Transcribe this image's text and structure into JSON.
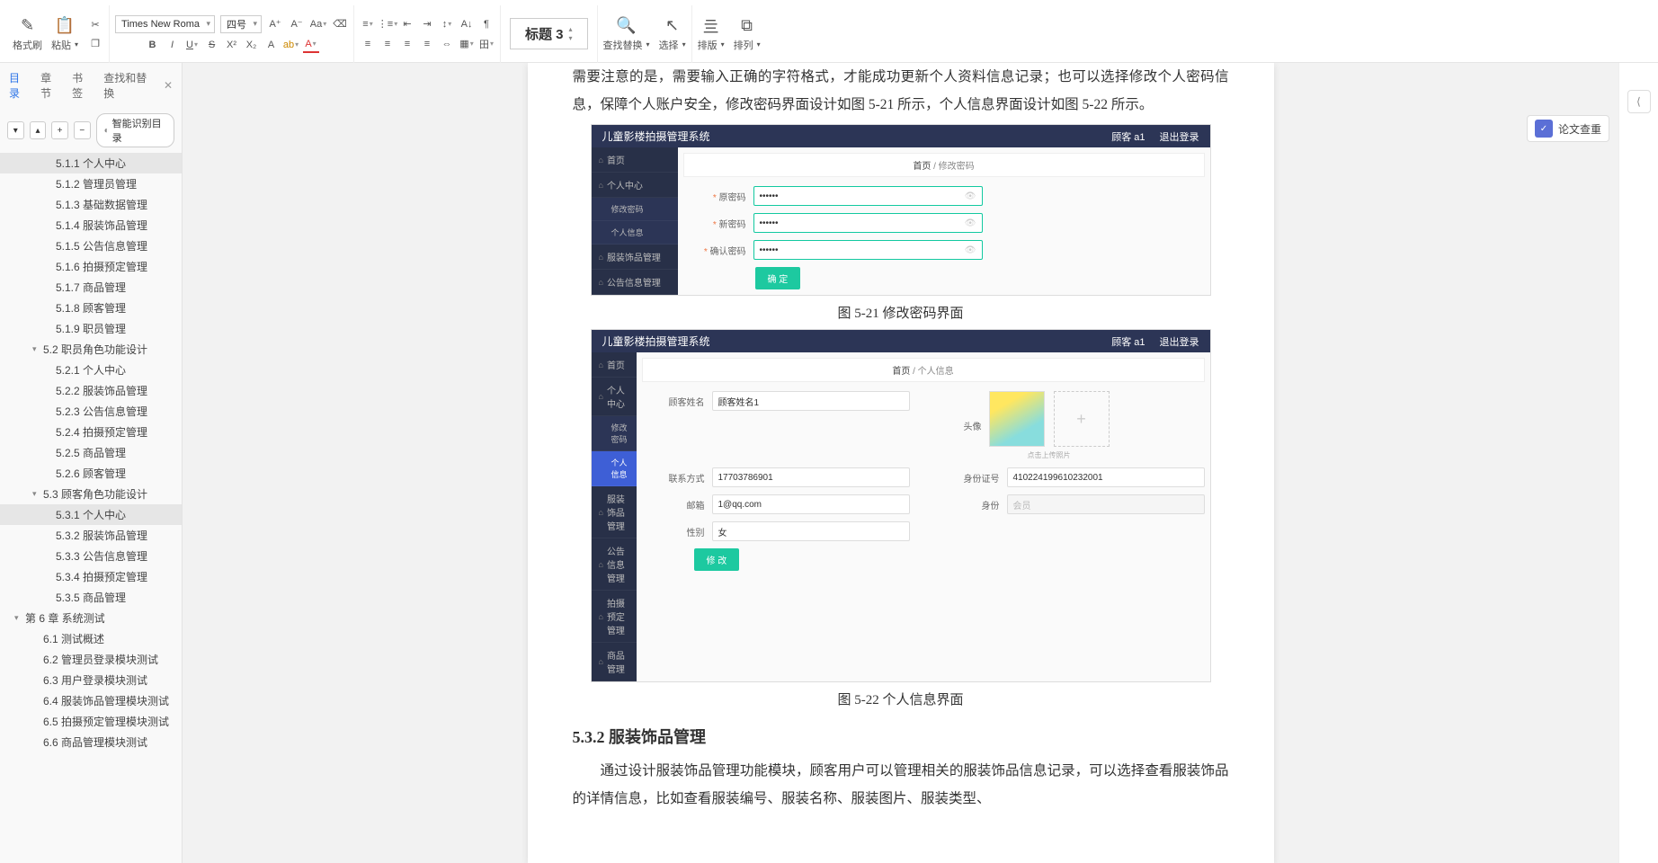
{
  "ribbon": {
    "format_painter": "格式刷",
    "paste": "粘贴",
    "font_name": "Times New Roma",
    "font_size": "四号",
    "style_preview": "标题 3",
    "find_replace": "查找替换",
    "select": "选择",
    "sort": "排版",
    "arrange": "排列"
  },
  "nav": {
    "tabs": {
      "toc": "目录",
      "chapter": "章节",
      "bookmark": "书签",
      "find": "查找和替换"
    },
    "smart": "智能识别目录",
    "items": [
      {
        "txt": "5.1.1 个人中心",
        "lv": 3,
        "active": true
      },
      {
        "txt": "5.1.2 管理员管理",
        "lv": 3
      },
      {
        "txt": "5.1.3 基础数据管理",
        "lv": 3
      },
      {
        "txt": "5.1.4 服装饰品管理",
        "lv": 3
      },
      {
        "txt": "5.1.5 公告信息管理",
        "lv": 3
      },
      {
        "txt": "5.1.6 拍摄预定管理",
        "lv": 3
      },
      {
        "txt": "5.1.7 商品管理",
        "lv": 3
      },
      {
        "txt": "5.1.8 顾客管理",
        "lv": 3
      },
      {
        "txt": "5.1.9 职员管理",
        "lv": 3
      },
      {
        "txt": "5.2 职员角色功能设计",
        "lv": 2,
        "caret": true
      },
      {
        "txt": "5.2.1 个人中心",
        "lv": 3
      },
      {
        "txt": "5.2.2 服装饰品管理",
        "lv": 3
      },
      {
        "txt": "5.2.3 公告信息管理",
        "lv": 3
      },
      {
        "txt": "5.2.4 拍摄预定管理",
        "lv": 3
      },
      {
        "txt": "5.2.5 商品管理",
        "lv": 3
      },
      {
        "txt": "5.2.6 顾客管理",
        "lv": 3
      },
      {
        "txt": "5.3 顾客角色功能设计",
        "lv": 2,
        "caret": true
      },
      {
        "txt": "5.3.1 个人中心",
        "lv": 3,
        "active": true
      },
      {
        "txt": "5.3.2 服装饰品管理",
        "lv": 3
      },
      {
        "txt": "5.3.3 公告信息管理",
        "lv": 3
      },
      {
        "txt": "5.3.4 拍摄预定管理",
        "lv": 3
      },
      {
        "txt": "5.3.5 商品管理",
        "lv": 3
      },
      {
        "txt": "第 6 章  系统测试",
        "lv": 1,
        "caret": true
      },
      {
        "txt": "6.1 测试概述",
        "lv": 2
      },
      {
        "txt": "6.2 管理员登录模块测试",
        "lv": 2
      },
      {
        "txt": "6.3 用户登录模块测试",
        "lv": 2
      },
      {
        "txt": "6.4 服装饰品管理模块测试",
        "lv": 2
      },
      {
        "txt": "6.5 拍摄预定管理模块测试",
        "lv": 2
      },
      {
        "txt": "6.6 商品管理模块测试",
        "lv": 2
      }
    ]
  },
  "doc": {
    "p1": "需要注意的是，需要输入正确的字符格式，才能成功更新个人资料信息记录；也可以选择修改个人密码信息，保障个人账户安全，修改密码界面设计如图 5-21 所示，个人信息界面设计如图 5-22 所示。",
    "cap1": "图 5-21 修改密码界面",
    "cap2": "图 5-22 个人信息界面",
    "h2": "5.3.2 服装饰品管理",
    "p2": "通过设计服装饰品管理功能模块，顾客用户可以管理相关的服装饰品信息记录，可以选择查看服装饰品的详情信息，比如查看服装编号、服装名称、服装图片、服装类型、"
  },
  "shot": {
    "sys_title": "儿童影楼拍摄管理系统",
    "user": "顾客 a1",
    "logout": "退出登录",
    "side": {
      "home": "首页",
      "center": "个人中心",
      "pwd": "修改密码",
      "info": "个人信息",
      "fashion": "服装饰品管理",
      "notice": "公告信息管理",
      "resv": "拍摄预定管理",
      "goods": "商品管理"
    },
    "crumb_home": "首页",
    "crumb_sep": " / ",
    "crumb1": "修改密码",
    "crumb2": "个人信息",
    "pwd_form": {
      "old": "原密码",
      "new": "新密码",
      "cfm": "确认密码",
      "val": "••••••",
      "btn": "确 定"
    },
    "info_form": {
      "name_lbl": "顾客姓名",
      "name_val": "顾客姓名1",
      "avatar_lbl": "头像",
      "avatar_tip": "点击上传照片",
      "phone_lbl": "联系方式",
      "phone_val": "17703786901",
      "idno_lbl": "身份证号",
      "idno_val": "410224199610232001",
      "email_lbl": "邮箱",
      "email_val": "1@qq.com",
      "job_lbl": "身份",
      "job_val": "会员",
      "sex_lbl": "性别",
      "sex_val": "女",
      "btn": "修 改"
    }
  },
  "right": {
    "pill": "论文查重"
  }
}
